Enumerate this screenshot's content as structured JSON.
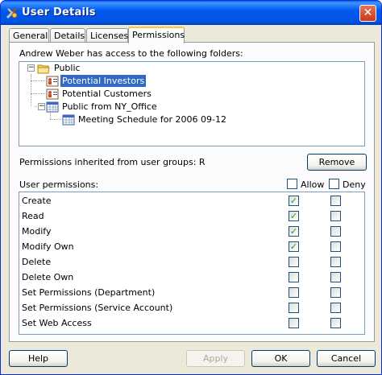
{
  "window": {
    "title": "User Details",
    "close_glyph": "✕",
    "title_icon": "user-tool-icon"
  },
  "tabs": [
    {
      "label": "General",
      "active": false
    },
    {
      "label": "Details",
      "active": false
    },
    {
      "label": "Licenses",
      "active": false
    },
    {
      "label": "Permissions",
      "active": true
    }
  ],
  "folders": {
    "label": "Andrew Weber has access to the following folders:",
    "tree": [
      {
        "label": "Public",
        "icon": "folder-icon",
        "toggle": "−",
        "selected": false
      },
      {
        "label": "Potential Investors",
        "icon": "contacts-icon",
        "selected": true
      },
      {
        "label": "Potential Customers",
        "icon": "contacts-icon",
        "selected": false
      },
      {
        "label": "Public from NY_Office",
        "icon": "calendar-icon",
        "toggle": "−",
        "selected": false
      },
      {
        "label": "Meeting Schedule for 2006 09-12",
        "icon": "calendar-icon",
        "selected": false
      }
    ]
  },
  "inherited": {
    "label": "Permissions inherited from user groups: R",
    "remove_label": "Remove"
  },
  "permissions": {
    "label": "User permissions:",
    "allow_header": "Allow",
    "deny_header": "Deny",
    "check_glyph": "✓",
    "rows": [
      {
        "name": "Create",
        "allow": true,
        "deny": false
      },
      {
        "name": "Read",
        "allow": true,
        "deny": false
      },
      {
        "name": "Modify",
        "allow": true,
        "deny": false
      },
      {
        "name": "Modify Own",
        "allow": true,
        "deny": false
      },
      {
        "name": "Delete",
        "allow": false,
        "deny": false
      },
      {
        "name": "Delete Own",
        "allow": false,
        "deny": false
      },
      {
        "name": "Set Permissions (Department)",
        "allow": false,
        "deny": false
      },
      {
        "name": "Set Permissions (Service Account)",
        "allow": false,
        "deny": false
      },
      {
        "name": "Set Web Access",
        "allow": false,
        "deny": false
      }
    ]
  },
  "buttons": {
    "help": "Help",
    "apply": "Apply",
    "ok": "OK",
    "cancel": "Cancel"
  },
  "colors": {
    "titlebar": "#0054E3",
    "selection": "#316AC5",
    "dialog_bg": "#ECE9D8",
    "check": "#21A121"
  }
}
